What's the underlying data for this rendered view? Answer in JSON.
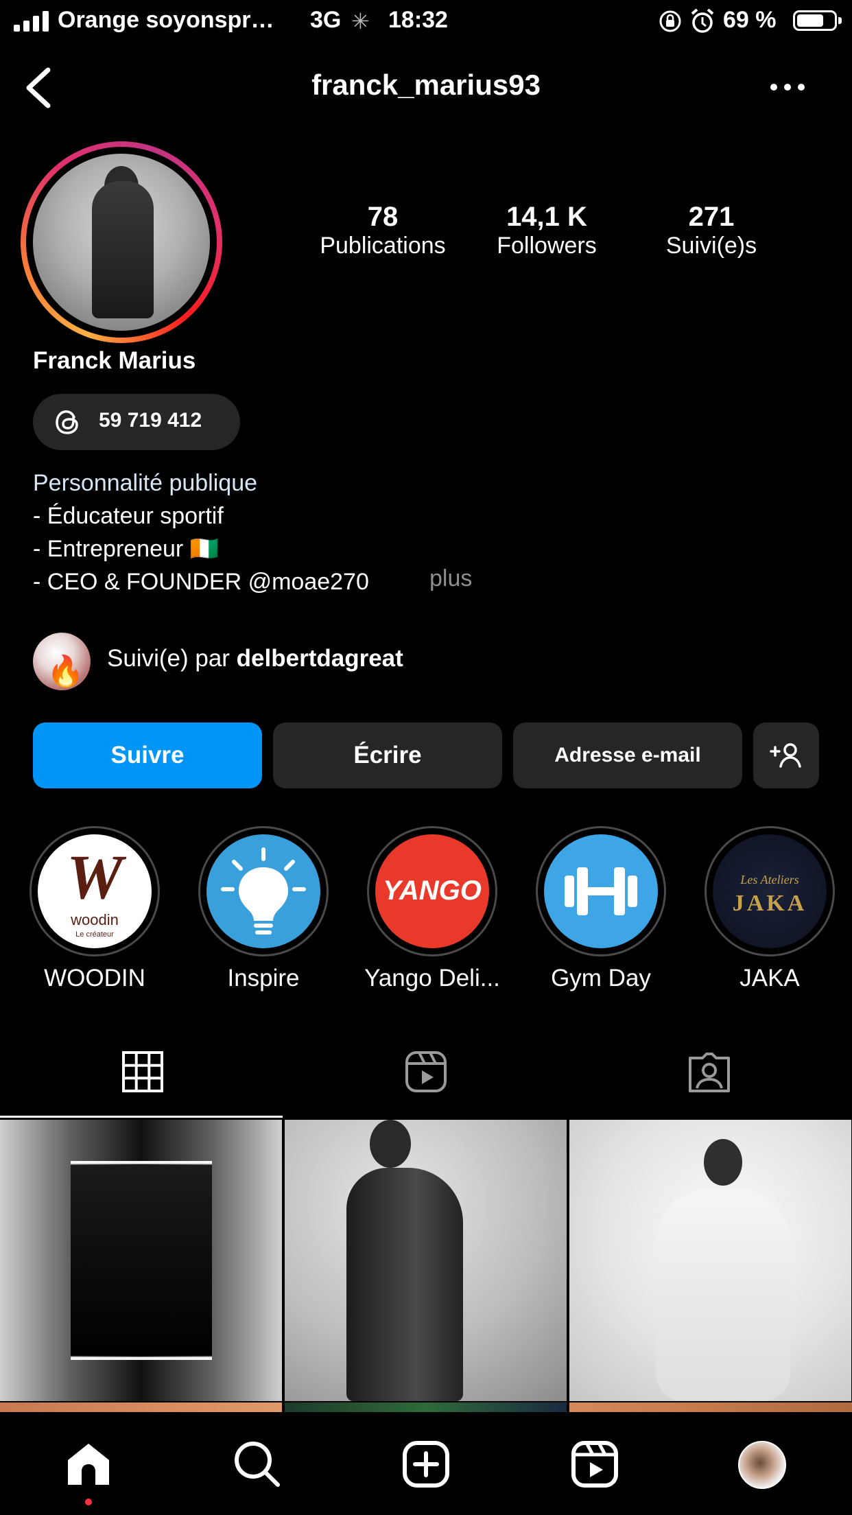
{
  "status_bar": {
    "carrier": "Orange soyonspr…",
    "network": "3G",
    "time": "18:32",
    "battery": "69 %"
  },
  "header": {
    "username": "franck_marius93"
  },
  "profile": {
    "stats": [
      {
        "value": "78",
        "label": "Publications"
      },
      {
        "value": "14,1 K",
        "label": "Followers"
      },
      {
        "value": "271",
        "label": "Suivi(e)s"
      }
    ],
    "name": "Franck Marius",
    "threads_count": "59 719 412",
    "bio": [
      "Personnalité publique",
      "- Éducateur sportif",
      "- Entrepreneur 🇨🇮",
      "- CEO & FOUNDER @moae270"
    ],
    "bio_more": "plus",
    "followed_by_prefix": "Suivi(e) par ",
    "followed_by_user": "delbertdagreat"
  },
  "actions": {
    "follow": "Suivre",
    "message": "Écrire",
    "email": "Adresse e-mail"
  },
  "highlights": [
    {
      "label": "WOODIN"
    },
    {
      "label": "Inspire"
    },
    {
      "label": "Yango Deli..."
    },
    {
      "label": "Gym Day"
    },
    {
      "label": "JAKA"
    }
  ],
  "highlight_logos": {
    "woodin_mark": "W",
    "woodin_name": "woodin",
    "woodin_tag": "Le créateur",
    "yango": "YANGO",
    "jaka_small": "Les Ateliers",
    "jaka": "JAKA"
  },
  "colors": {
    "accent_blue": "#0095f6",
    "button_gray": "#262626",
    "notification_red": "#ff3040"
  }
}
